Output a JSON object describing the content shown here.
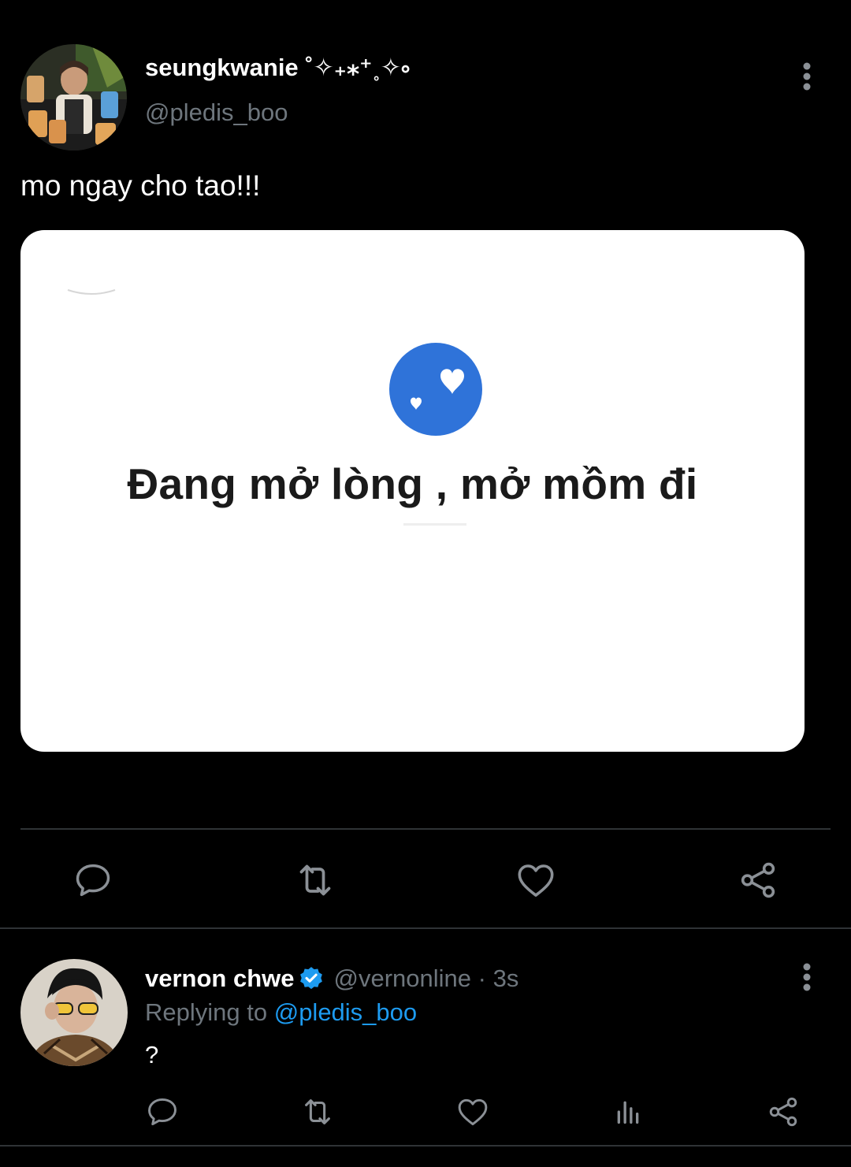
{
  "colors": {
    "background": "#000000",
    "text_primary": "#ffffff",
    "text_secondary": "#6e767d",
    "accent_blue": "#1d9bf0",
    "divider": "#2f3336",
    "media_heart_circle": "#2f73d9"
  },
  "main_tweet": {
    "author": {
      "display_name": "seungkwanie ˚✧₊⁎⁺˳✧༚",
      "handle": "@pledis_boo",
      "avatar_icon": "user-avatar"
    },
    "text": "mo ngay cho tao!!!",
    "media": {
      "icon": "hearts-badge-icon",
      "caption": "Đang mở lòng , mở mồm đi"
    },
    "actions": {
      "reply_icon": "reply-icon",
      "retweet_icon": "retweet-icon",
      "like_icon": "heart-icon",
      "share_icon": "share-icon"
    },
    "more_icon": "more-vertical-icon"
  },
  "reply_tweet": {
    "author": {
      "display_name": "vernon chwe",
      "verified_icon": "verified-badge-icon",
      "handle": "@vernonline",
      "separator": " · ",
      "time": "3s"
    },
    "replying_prefix": "Replying to ",
    "replying_to": "@pledis_boo",
    "text": "?",
    "actions": {
      "reply_icon": "reply-icon",
      "retweet_icon": "retweet-icon",
      "like_icon": "heart-icon",
      "analytics_icon": "analytics-icon",
      "share_icon": "share-icon"
    },
    "more_icon": "more-vertical-icon"
  }
}
